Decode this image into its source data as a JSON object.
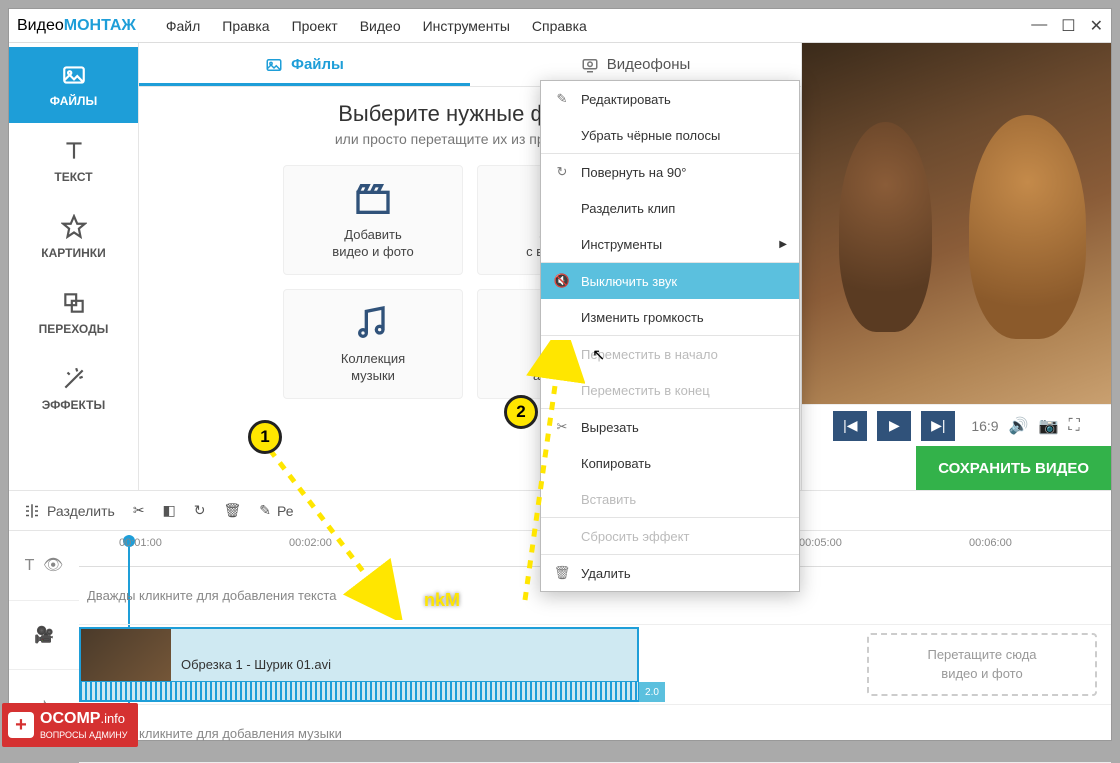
{
  "app": {
    "name_a": "Видео",
    "name_b": "МОНТАЖ"
  },
  "menu": [
    "Файл",
    "Правка",
    "Проект",
    "Видео",
    "Инструменты",
    "Справка"
  ],
  "sidebar": [
    {
      "label": "ФАЙЛЫ",
      "icon": "image"
    },
    {
      "label": "ТЕКСТ",
      "icon": "text"
    },
    {
      "label": "КАРТИНКИ",
      "icon": "star"
    },
    {
      "label": "ПЕРЕХОДЫ",
      "icon": "copy"
    },
    {
      "label": "ЭФФЕКТЫ",
      "icon": "wand"
    }
  ],
  "tabs": {
    "files": "Файлы",
    "backgrounds": "Видеофоны"
  },
  "heading": "Выберите нужные файлы",
  "subheading": "или просто перетащите их из проводника",
  "tiles": [
    {
      "label": "Добавить\nвидео и фото",
      "icon": "clapper"
    },
    {
      "label": "Записать\nс веб-камеры",
      "icon": "webcam"
    },
    {
      "label": "Коллекция\nмузыки",
      "icon": "notes"
    },
    {
      "label": "Добавить\nаудиофайл",
      "icon": "mic"
    }
  ],
  "player": {
    "aspect": "16:9"
  },
  "save_button": "СОХРАНИТЬ ВИДЕО",
  "toolbar": {
    "split": "Разделить",
    "edit": "Ре"
  },
  "ruler": [
    "00:01:00",
    "00:02:00",
    "",
    "",
    "00:05:00",
    "00:06:00"
  ],
  "text_track_hint": "Дважды кликните для добавления текста",
  "audio_track_hint": "Дважды кликните для добавления музыки",
  "dropzone": "Перетащите сюда\nвидео и фото",
  "clip": {
    "name": "Обрезка 1 - Шурик 01.avi",
    "speed": "2.0"
  },
  "context": [
    {
      "label": "Редактировать",
      "icon": "✎"
    },
    {
      "label": "Убрать чёрные полосы",
      "icon": ""
    },
    {
      "sep": true
    },
    {
      "label": "Повернуть на 90°",
      "icon": "↻"
    },
    {
      "label": "Разделить клип",
      "icon": ""
    },
    {
      "label": "Инструменты",
      "icon": "",
      "arrow": true
    },
    {
      "sep": true
    },
    {
      "label": "Выключить звук",
      "icon": "🔇",
      "highlight": true
    },
    {
      "label": "Изменить громкость",
      "icon": ""
    },
    {
      "sep": true
    },
    {
      "label": "Переместить в начало",
      "icon": "⇄",
      "disabled": true
    },
    {
      "label": "Переместить в конец",
      "icon": "",
      "disabled": true
    },
    {
      "sep": true
    },
    {
      "label": "Вырезать",
      "icon": "✂"
    },
    {
      "label": "Копировать",
      "icon": ""
    },
    {
      "label": "Вставить",
      "icon": "",
      "disabled": true
    },
    {
      "sep": true
    },
    {
      "label": "Сбросить эффект",
      "icon": "",
      "disabled": true
    },
    {
      "sep": true
    },
    {
      "label": "Удалить",
      "icon": "🗑"
    }
  ],
  "annotations": {
    "a1": "1",
    "a2": "2",
    "nkm": "nkM"
  },
  "badge": {
    "brand": "OCOMP",
    "tld": ".info",
    "tag": "ВОПРОСЫ АДМИНУ"
  }
}
